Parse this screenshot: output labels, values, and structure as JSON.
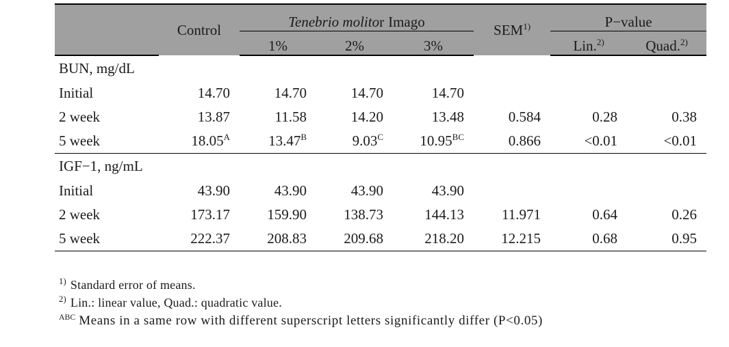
{
  "table": {
    "header": {
      "control": "Control",
      "group_species_italic": "Tenebrio molito",
      "group_species_tail": "r",
      "group_imago": "Imago",
      "levels": [
        "1%",
        "2%",
        "3%"
      ],
      "sem": "SEM",
      "sem_sup": "1)",
      "pvalue": "P−value",
      "lin": "Lin.",
      "lin_sup": "2)",
      "quad": "Quad.",
      "quad_sup": "2)"
    },
    "sections": [
      {
        "title": "BUN, mg/dL",
        "rows": [
          {
            "label": "Initial",
            "cells": [
              {
                "value": "14.70",
                "sup": ""
              },
              {
                "value": "14.70",
                "sup": ""
              },
              {
                "value": "14.70",
                "sup": ""
              },
              {
                "value": "14.70",
                "sup": ""
              },
              {
                "value": "",
                "sup": ""
              },
              {
                "value": "",
                "sup": ""
              },
              {
                "value": "",
                "sup": ""
              }
            ]
          },
          {
            "label": "2 week",
            "cells": [
              {
                "value": "13.87",
                "sup": ""
              },
              {
                "value": "11.58",
                "sup": ""
              },
              {
                "value": "14.20",
                "sup": ""
              },
              {
                "value": "13.48",
                "sup": ""
              },
              {
                "value": "0.584",
                "sup": ""
              },
              {
                "value": "0.28",
                "sup": ""
              },
              {
                "value": "0.38",
                "sup": ""
              }
            ]
          },
          {
            "label": "5 week",
            "cells": [
              {
                "value": "18.05",
                "sup": "A"
              },
              {
                "value": "13.47",
                "sup": "B"
              },
              {
                "value": "9.03",
                "sup": "C"
              },
              {
                "value": "10.95",
                "sup": "BC"
              },
              {
                "value": "0.866",
                "sup": ""
              },
              {
                "value": "<0.01",
                "sup": ""
              },
              {
                "value": "<0.01",
                "sup": ""
              }
            ]
          }
        ]
      },
      {
        "title": "IGF−1, ng/mL",
        "rows": [
          {
            "label": "Initial",
            "cells": [
              {
                "value": "43.90",
                "sup": ""
              },
              {
                "value": "43.90",
                "sup": ""
              },
              {
                "value": "43.90",
                "sup": ""
              },
              {
                "value": "43.90",
                "sup": ""
              },
              {
                "value": "",
                "sup": ""
              },
              {
                "value": "",
                "sup": ""
              },
              {
                "value": "",
                "sup": ""
              }
            ]
          },
          {
            "label": "2 week",
            "cells": [
              {
                "value": "173.17",
                "sup": ""
              },
              {
                "value": "159.90",
                "sup": ""
              },
              {
                "value": "138.73",
                "sup": ""
              },
              {
                "value": "144.13",
                "sup": ""
              },
              {
                "value": "11.971",
                "sup": ""
              },
              {
                "value": "0.64",
                "sup": ""
              },
              {
                "value": "0.26",
                "sup": ""
              }
            ]
          },
          {
            "label": "5 week",
            "cells": [
              {
                "value": "222.37",
                "sup": ""
              },
              {
                "value": "208.83",
                "sup": ""
              },
              {
                "value": "209.68",
                "sup": ""
              },
              {
                "value": "218.20",
                "sup": ""
              },
              {
                "value": "12.215",
                "sup": ""
              },
              {
                "value": "0.68",
                "sup": ""
              },
              {
                "value": "0.95",
                "sup": ""
              }
            ]
          }
        ]
      }
    ]
  },
  "footnotes": [
    {
      "marker": "1)",
      "text": "Standard error of means."
    },
    {
      "marker": "2)",
      "text": "Lin.: linear value, Quad.: quadratic value."
    },
    {
      "marker": "ABC",
      "text": "Means in a same row with different superscript letters significantly differ (P<0.05)"
    }
  ],
  "colors": {
    "header_background": "#a0a0a0",
    "text": "#1a1a1a",
    "rule": "#000000",
    "page_background": "#ffffff"
  }
}
